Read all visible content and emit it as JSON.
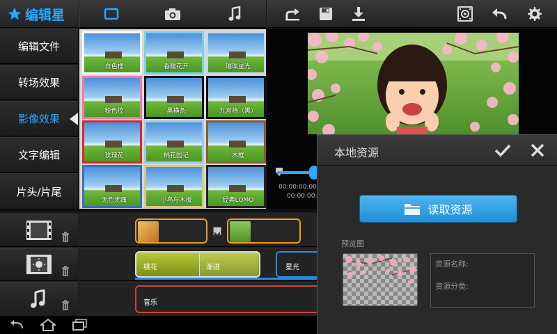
{
  "app": {
    "title": "编辑星"
  },
  "toolbar": {
    "icons": [
      "window-icon",
      "camera-icon",
      "music-icon",
      "share-icon",
      "save-icon",
      "download-icon",
      "settings-film-icon",
      "back-icon",
      "gear-icon"
    ],
    "accent": "#2aa7ff"
  },
  "sidebar": {
    "items": [
      {
        "label": "编辑文件"
      },
      {
        "label": "转场效果"
      },
      {
        "label": "影像效果",
        "active": true
      },
      {
        "label": "文字编辑"
      },
      {
        "label": "片头/片尾"
      }
    ]
  },
  "effects": [
    {
      "label": "白色框",
      "frame": "#ffffff"
    },
    {
      "label": "春暖花开",
      "frame": "#7bd0e8"
    },
    {
      "label": "璀璨星光",
      "frame": "#c8d8e8"
    },
    {
      "label": "粉色控",
      "frame": "#f07aa8"
    },
    {
      "label": "黑横条",
      "frame": "#111111"
    },
    {
      "label": "九宫格（黑）",
      "frame": "#111111"
    },
    {
      "label": "玫瑰花",
      "frame": "#d8282c"
    },
    {
      "label": "桃花园记",
      "frame": "#9fc8e8"
    },
    {
      "label": "木框",
      "frame": "#8a5a2a"
    },
    {
      "label": "无色无痛",
      "frame": "#3a6fb8"
    },
    {
      "label": "小鸟与木板",
      "frame": "#d8c888"
    },
    {
      "label": "经典LOMO",
      "frame": "#222222"
    }
  ],
  "player": {
    "time_current": "00:00:00:00",
    "time_total": "00:00:00:00"
  },
  "timeline": {
    "text_clips": [
      {
        "label": "桃花"
      },
      {
        "label": "渐进"
      },
      {
        "label": "星光"
      }
    ],
    "music_clip": {
      "label": "音乐"
    }
  },
  "dialog": {
    "title": "本地资源",
    "load_button": "读取资源",
    "preview_label": "预览图",
    "resource_name_label": "资源名称:",
    "resource_category_label": "资源分类:"
  }
}
